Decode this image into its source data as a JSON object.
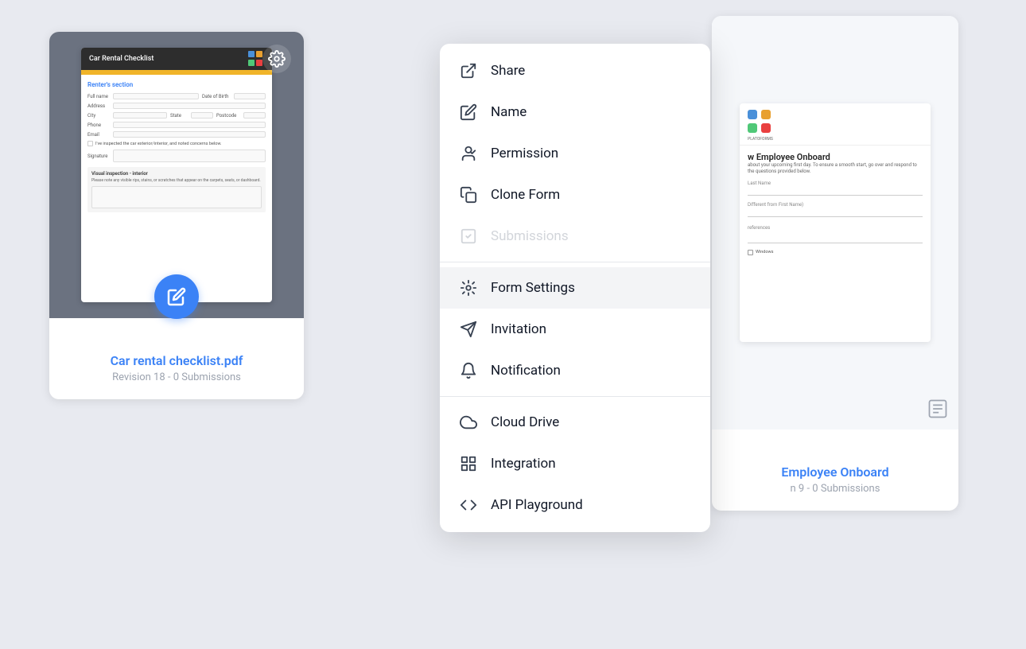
{
  "page": {
    "background_color": "#e8eaf0"
  },
  "card_left": {
    "preview_bg": "#6b7280",
    "form_title": "Car Rental Checklist",
    "section_title": "Renter's section",
    "fields": [
      "Full name",
      "Date of Birth",
      "Address",
      "City",
      "State",
      "Postcode",
      "Phone",
      "Email"
    ],
    "checkbox_text": "I've inspected the car exterior/interior, and noted concerns below.",
    "signature_label": "Signature",
    "visual_section_title": "Visual inspection - interior",
    "visual_section_text": "Please note any visible rips, stains, or scratches that appear on the carpets, seats, or dashboard.",
    "fab_icon": "✏",
    "title": "Car rental checklist.pdf",
    "subtitle": "Revision 18 - 0 Submissions"
  },
  "card_right": {
    "form_title": "w Employee Onboard",
    "form_text": "about your upcoming first day. To ensure a smooth start, go over and respond to the questions provided below.",
    "field1_label": "Last Name",
    "field2_label": "Different from First Name)",
    "field3_label": "references",
    "field4_label": "Windows",
    "title": "Employee Onboard",
    "subtitle": "n 9 - 0 Submissions"
  },
  "gear_icon": "⚙",
  "menu": {
    "items": [
      {
        "id": "share",
        "label": "Share",
        "icon": "share",
        "disabled": false,
        "active": false
      },
      {
        "id": "name",
        "label": "Name",
        "icon": "name",
        "disabled": false,
        "active": false
      },
      {
        "id": "permission",
        "label": "Permission",
        "icon": "permission",
        "disabled": false,
        "active": false
      },
      {
        "id": "clone",
        "label": "Clone Form",
        "icon": "clone",
        "disabled": false,
        "active": false
      },
      {
        "id": "submissions",
        "label": "Submissions",
        "icon": "submissions",
        "disabled": true,
        "active": false
      },
      {
        "id": "form-settings",
        "label": "Form Settings",
        "icon": "settings",
        "disabled": false,
        "active": true
      },
      {
        "id": "invitation",
        "label": "Invitation",
        "icon": "invitation",
        "disabled": false,
        "active": false
      },
      {
        "id": "notification",
        "label": "Notification",
        "icon": "notification",
        "disabled": false,
        "active": false
      },
      {
        "id": "cloud-drive",
        "label": "Cloud Drive",
        "icon": "cloud",
        "disabled": false,
        "active": false
      },
      {
        "id": "integration",
        "label": "Integration",
        "icon": "integration",
        "disabled": false,
        "active": false
      },
      {
        "id": "api",
        "label": "API Playground",
        "icon": "api",
        "disabled": false,
        "active": false
      }
    ]
  }
}
